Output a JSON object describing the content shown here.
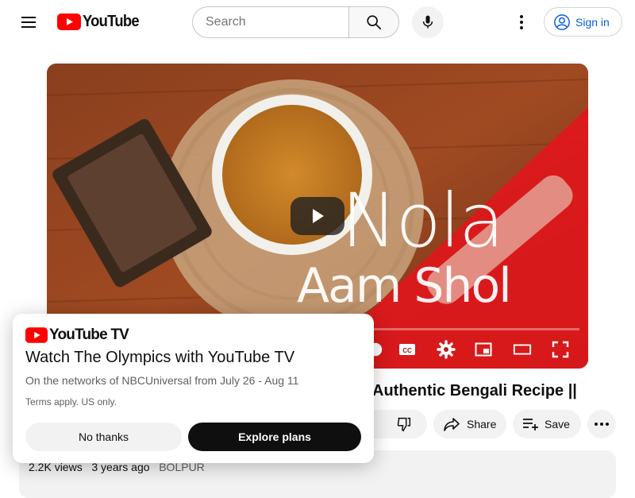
{
  "header": {
    "logo_text": "YouTube",
    "search_placeholder": "Search",
    "signin_label": "Sign in"
  },
  "player": {
    "overlay_line1": "Nola",
    "overlay_line2": "Aam Shol"
  },
  "video": {
    "title": "Authentic Bengali Recipe ||",
    "share_label": "Share",
    "save_label": "Save",
    "views": "2.2K views",
    "age": "3 years ago",
    "location": "BOLPUR"
  },
  "promo": {
    "logo_text": "YouTube TV",
    "title": "Watch The Olympics with YouTube TV",
    "subtitle": "On the networks of NBCUniversal from July 26 - Aug 11",
    "terms": "Terms apply. US only.",
    "no_thanks_label": "No thanks",
    "explore_label": "Explore plans"
  },
  "colors": {
    "brand_red": "#ff0000",
    "link_blue": "#065fd4",
    "pill_bg": "#f2f2f2"
  }
}
